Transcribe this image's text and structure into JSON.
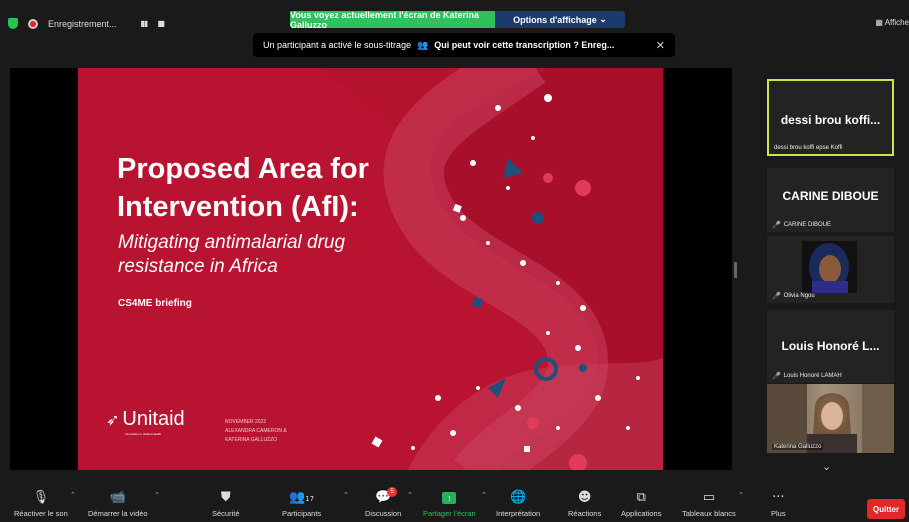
{
  "topbar": {
    "recording_label": "Enregistrement...",
    "share_message": "Vous voyez actuellement l'écran de Katerina Galluzzo",
    "view_options": "Options d'affichage",
    "caption_notice": "Un participant a activé le sous-titrage",
    "caption_question": "Qui peut voir cette transcription ? Enreg...",
    "afficher": "Affiche"
  },
  "slide": {
    "title_line1": "Proposed Area for",
    "title_line2": "Intervention (AfI):",
    "subtitle_line1": "Mitigating antimalarial drug",
    "subtitle_line2": "resistance in Africa",
    "briefing": "CS4ME briefing",
    "logo": "Unitaid",
    "logo_tag": "Innovation in Global Health",
    "date": "NOVEMBER 2022",
    "authors_line1": "ALEXANDRA CAMERON &",
    "authors_line2": "KATERINA GALLUZZO",
    "colors": {
      "background": "#b5122e",
      "dots": "#ffffff",
      "accent": "#1e4f7d"
    }
  },
  "participants": [
    {
      "display": "dessi brou koffi...",
      "label": "dessi brou koffi  epse Koffi",
      "active_speaker": true
    },
    {
      "display": "CARINE DIBOUE",
      "label": "CARINE DIBOUE",
      "muted": true
    },
    {
      "display": "",
      "label": "Olivia Ngou",
      "muted": true,
      "has_photo": true
    },
    {
      "display": "Louis Honoré L...",
      "label": "Louis Honoré LAMAH",
      "muted": true
    },
    {
      "display": "",
      "label": "Katerina Galluzzo",
      "has_video": true
    }
  ],
  "toolbar": {
    "unmute": "Réactiver le son",
    "start_video": "Démarrer la vidéo",
    "security": "Sécurité",
    "participants": "Participants",
    "participants_count": "17",
    "chat": "Discussion",
    "chat_badge": "5",
    "share": "Partager l'écran",
    "interpretation": "Interprétation",
    "reactions": "Réactions",
    "apps": "Applications",
    "whiteboards": "Tableaux blancs",
    "more": "Plus",
    "quit": "Quitter"
  }
}
